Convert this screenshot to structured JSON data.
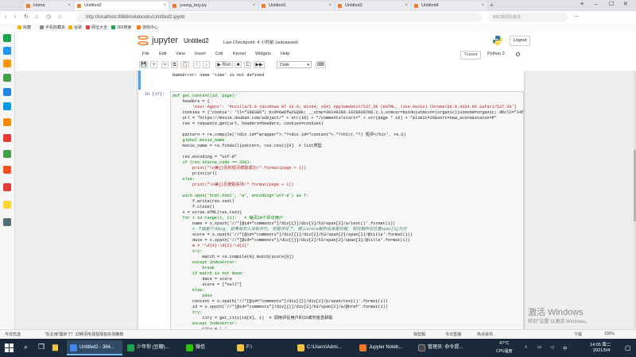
{
  "browser": {
    "tabs": [
      {
        "label": "Home",
        "active": false
      },
      {
        "label": "Untitled2",
        "active": true
      },
      {
        "label": "young_boy.py",
        "active": false
      },
      {
        "label": "Untitled1",
        "active": false
      },
      {
        "label": "Untitled3",
        "active": false
      },
      {
        "label": "Untitled4",
        "active": false
      }
    ],
    "new_tab": "+",
    "url": "http://localhost:8888/notebooks/Untitled2.ipynb",
    "search_placeholder": "BBC新闻负数责",
    "bookmarks": [
      "收藏",
      "手机收藏夹",
      "谷歌",
      "网址大全",
      "360搜索",
      "游戏中心"
    ]
  },
  "jupyter": {
    "title": "jupyter",
    "notebook_name": "Untitled2",
    "checkpoint": "Last Checkpoint: 4 小时前  (autosaved)",
    "logout": "Logout",
    "menus": [
      "File",
      "Edit",
      "View",
      "Insert",
      "Cell",
      "Kernel",
      "Widgets",
      "Help"
    ],
    "trusted": "Trusted",
    "kernel": "Python 3",
    "toolbar": {
      "save": "💾",
      "add": "+",
      "cut": "✂",
      "copy": "⧉",
      "paste": "📋",
      "up": "↑",
      "down": "↓",
      "run": "▶ Run",
      "stop": "■",
      "restart": "C",
      "restart_run": "▶▶",
      "cell_type": "Code",
      "palette": "⌨"
    }
  },
  "notebook": {
    "prev_output": "NameError: name 'time' is not defined",
    "prompt": "In  [17]:",
    "code_lines": [
      {
        "t": "def get_content(id, page):",
        "c": "kw"
      },
      {
        "t": "    headers = {",
        "c": ""
      },
      {
        "t": "        'User-Agent': 'Mozilla/5.0 (Windows NT 10.0; Win64; x64) AppleWebKit/537.36 (KHTML, like Gecko) Chrome/88.0.4324.96 Safari/537.36'}",
        "c": "str"
      },
      {
        "t": "    cookies = {'cookie': 'll=\"108306\"; bid=6w6fw2SQ0k; __utmz=30149280.1629928708.1.1.utmcsr=baidu|utmccn=(organic)|utmcmd=organic; dbcl2=\"145'}",
        "c": ""
      },
      {
        "t": "    url = \"https://movie.douban.com/subject/\" + str(id) + \"/comments?start=\" + str(page * 10) + \"&limit=20&sort=new_score&status=P\"",
        "c": ""
      },
      {
        "t": "    res = requests.get(url, headers=headers, cookies=cookies)",
        "c": ""
      },
      {
        "t": "",
        "c": ""
      },
      {
        "t": "    pattern = re.compile('<div id=\"wrapper\">.*?<div id=\"content\">.*?<h1>(.*?) 短评</h1>', re.S)",
        "c": ""
      },
      {
        "t": "    global movie_name",
        "c": "kw"
      },
      {
        "t": "    movie_name = re.findall(pattern, res.text)[0]  # list类型",
        "c": ""
      },
      {
        "t": "",
        "c": ""
      },
      {
        "t": "    res.encoding = \"utf-8\"",
        "c": ""
      },
      {
        "t": "    if (res.status_code == 200):",
        "c": "kw"
      },
      {
        "t": "        print(\"\\n第{}页的短评爬取成功!\".format(page + 1))",
        "c": "str"
      },
      {
        "t": "        print(url)",
        "c": ""
      },
      {
        "t": "    else:",
        "c": "kw"
      },
      {
        "t": "        print(\"\\n第{}页爬取失败!\".format(page + 1))",
        "c": "str"
      },
      {
        "t": "",
        "c": ""
      },
      {
        "t": "    with open('html.html', 'w', encoding='utf-8') as f:",
        "c": "kw"
      },
      {
        "t": "        f.write(res.text)",
        "c": ""
      },
      {
        "t": "        f.close()",
        "c": ""
      },
      {
        "t": "    x = etree.HTML(res.text)",
        "c": ""
      },
      {
        "t": "    for i in range(1, 21):   # 每页20个评论用户",
        "c": "kw"
      },
      {
        "t": "        name = x.xpath('//*[@id=\"comments\"]/div[{}]/div[2]/h3/span[2]/a/text()'.format(i))",
        "c": ""
      },
      {
        "t": "        # 下面是个大bug, 如果有的人没有评分, 但是评论了, 那么score解析出来是日期, 而日期所在位置span[3]为空",
        "c": "cm"
      },
      {
        "t": "        score = x.xpath('//*[@id=\"comments\"]/div[{}]/div[2]/h3/span[2]/span[2]/@title'.format(i))",
        "c": ""
      },
      {
        "t": "        date = x.xpath('//*[@id=\"comments\"]/div[{}]/div[2]/h3/span[2]/span[3]/@title'.format(i))",
        "c": ""
      },
      {
        "t": "        m = '\\d{4}-\\d{2}-\\d{2}'",
        "c": "str"
      },
      {
        "t": "        try:",
        "c": "kw"
      },
      {
        "t": "            match = re.compile(m).match(score[0])",
        "c": ""
      },
      {
        "t": "        except IndexError:",
        "c": "kw"
      },
      {
        "t": "            break",
        "c": "kw"
      },
      {
        "t": "        if match is not None:",
        "c": "kw"
      },
      {
        "t": "            date = score",
        "c": ""
      },
      {
        "t": "            score = [\"null\"]",
        "c": ""
      },
      {
        "t": "        else:",
        "c": "kw"
      },
      {
        "t": "            pass",
        "c": "kw"
      },
      {
        "t": "        content = x.xpath('//*[@id=\"comments\"]/div[{}]/div[2]/p/span/text()'.format(i))",
        "c": ""
      },
      {
        "t": "        id = x.xpath('//*[@id=\"comments\"]/div[{}]/div[2]/h3/span[2]/a/@href'.format(i))",
        "c": ""
      },
      {
        "t": "        try:",
        "c": "kw"
      },
      {
        "t": "            city = get_city(id[0], i)  # 调用评论用户的ID城市信息获取",
        "c": ""
      },
      {
        "t": "        except IndexError:",
        "c": "kw"
      },
      {
        "t": "            city = ' '",
        "c": ""
      }
    ],
    "watermark_title": "激活 Windows",
    "watermark_sub": "转到\"设置\"以激活 Windows。"
  },
  "statusbar": {
    "left": "今日优选",
    "news": "\"东北辣\"震碎了！32种羽毛球拍球拍实测推荐",
    "items": [
      "快剪辑",
      "今日直播",
      "热点资讯",
      "下载",
      "100%"
    ]
  },
  "taskbar": {
    "tasks": [
      {
        "label": "Untitled2 - 364...",
        "active": true,
        "color": "#4285f4"
      },
      {
        "label": "少年你 (豆瓣)...",
        "active": false,
        "color": "#1aa34a"
      },
      {
        "label": "微信",
        "active": false,
        "color": "#2dc100"
      },
      {
        "label": "F:\\",
        "active": false,
        "color": "#f5c242"
      },
      {
        "label": "C:\\Users\\Admi...",
        "active": false,
        "color": "#f5c242"
      },
      {
        "label": "Jupyter Noteb...",
        "active": false,
        "color": "#f37726"
      },
      {
        "label": "管理员: 命令提...",
        "active": false,
        "color": "#444444"
      }
    ],
    "temp": "47°C",
    "cpu": "CPU温度",
    "ime": "中",
    "time": "14:05 周二",
    "date": "2021/5/4"
  }
}
